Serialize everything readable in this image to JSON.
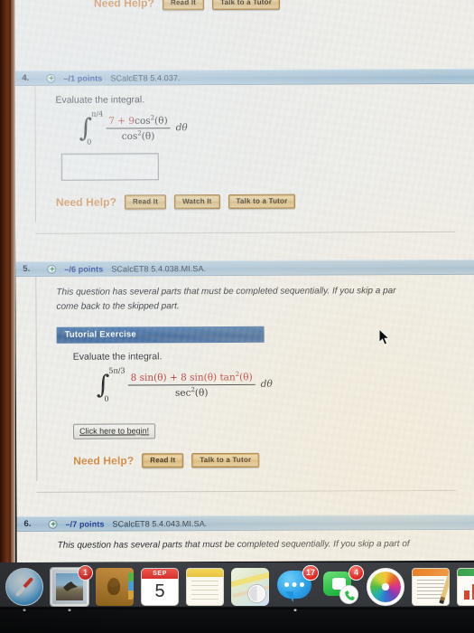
{
  "top_partial_row": {
    "label": "Need Help?",
    "buttons": [
      "Read It",
      "Talk to a Tutor"
    ]
  },
  "questions": [
    {
      "number": "4.",
      "points": "–/1 points",
      "code": "SCalcET8 5.4.037.",
      "prompt": "Evaluate the integral.",
      "integral": {
        "lower": "0",
        "upper": "π/4",
        "numerator_prefix": "7 + 9",
        "numerator_func": "cos",
        "numerator_exp": "2",
        "numerator_arg": "(θ)",
        "denominator_func": "cos",
        "denominator_exp": "2",
        "denominator_arg": "(θ)",
        "differential": "dθ"
      },
      "answer_value": "",
      "need_help_label": "Need Help?",
      "need_help_buttons": [
        "Read It",
        "Watch It",
        "Talk to a Tutor"
      ]
    },
    {
      "number": "5.",
      "points": "–/6 points",
      "code": "SCalcET8 5.4.038.MI.SA.",
      "notice_line1": "This question has several parts that must be completed sequentially. If you skip a par",
      "notice_line2": "come back to the skipped part.",
      "tutorial_header": "Tutorial Exercise",
      "prompt": "Evaluate the integral.",
      "integral": {
        "lower": "0",
        "upper": "5π/3",
        "num_a": "8 sin(θ) + 8 sin(θ) tan",
        "num_exp": "2",
        "num_b": "(θ)",
        "den_func": "sec",
        "den_exp": "2",
        "den_arg": "(θ)",
        "differential": "dθ"
      },
      "begin_button": "Click here to begin!",
      "need_help_label": "Need Help?",
      "need_help_buttons": [
        "Read It",
        "Talk to a Tutor"
      ]
    },
    {
      "number": "6.",
      "points": "–/7 points",
      "code": "SCalcET8 5.4.043.MI.SA.",
      "notice_line1": "This question has several parts that must be completed sequentially. If you skip a part of"
    }
  ],
  "dock": {
    "items": [
      {
        "name": "Safari",
        "icon": "safari-icon",
        "badge": "",
        "running": true
      },
      {
        "name": "Mail",
        "icon": "mail-icon",
        "badge": "1",
        "running": true
      },
      {
        "name": "Contacts",
        "icon": "contacts-icon",
        "badge": "",
        "running": false
      },
      {
        "name": "Calendar",
        "icon": "calendar-icon",
        "badge": "",
        "running": false,
        "month": "SEP",
        "day": "5"
      },
      {
        "name": "Notes",
        "icon": "notes-icon",
        "badge": "",
        "running": false
      },
      {
        "name": "Maps",
        "icon": "maps-icon",
        "badge": "",
        "running": false
      },
      {
        "name": "Messages",
        "icon": "messages-icon",
        "badge": "17",
        "running": true
      },
      {
        "name": "FaceTime",
        "icon": "facetime-icon",
        "badge": "4",
        "running": false
      },
      {
        "name": "Photos",
        "icon": "photos-icon",
        "badge": "",
        "running": false
      },
      {
        "name": "Pages",
        "icon": "pages-icon",
        "badge": "",
        "running": false
      },
      {
        "name": "Numbers",
        "icon": "numbers-icon",
        "badge": "",
        "running": false
      }
    ]
  },
  "colors": {
    "question_header_blue": "#a8c3d6",
    "points_text_blue": "#16308f",
    "need_help_orange": "#d2873c",
    "tutorial_header_blue": "#2d5b93",
    "math_red": "#b32020"
  }
}
